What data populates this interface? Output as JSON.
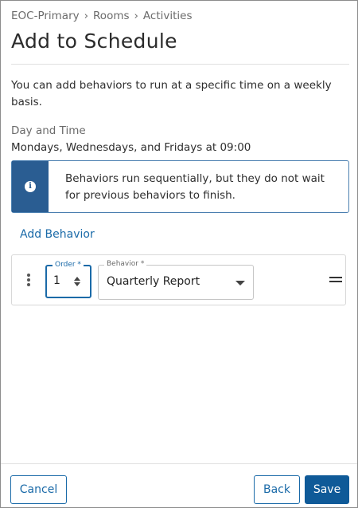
{
  "breadcrumb": {
    "items": [
      "EOC-Primary",
      "Rooms",
      "Activities"
    ],
    "separator": "›"
  },
  "page": {
    "title": "Add to Schedule",
    "description": "You can add behaviors to run at a specific time on a weekly basis."
  },
  "schedule": {
    "label": "Day and Time",
    "value": "Mondays, Wednesdays, and Fridays at 09:00"
  },
  "info_banner": {
    "icon": "info-icon",
    "text": "Behaviors run sequentially, but they do not wait for previous behaviors to finish."
  },
  "add_behavior_label": "Add Behavior",
  "behavior_row": {
    "order_label": "Order *",
    "order_value": "1",
    "behavior_label": "Behavior *",
    "behavior_value": "Quarterly Report"
  },
  "footer": {
    "cancel_label": "Cancel",
    "back_label": "Back",
    "save_label": "Save"
  },
  "colors": {
    "accent": "#1a6aa8",
    "primary_button": "#0f5a98",
    "info_bar": "#2a5d92"
  }
}
